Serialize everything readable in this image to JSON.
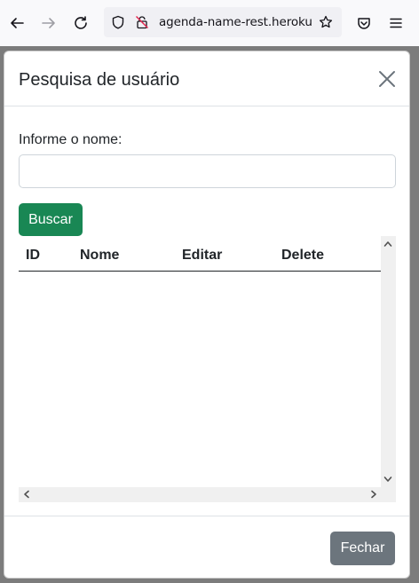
{
  "browser": {
    "url": "agenda-name-rest.herokuapp",
    "icons": [
      "back-arrow-icon",
      "forward-arrow-icon",
      "reload-icon",
      "shield-icon",
      "insecure-lock-icon",
      "star-icon",
      "pocket-icon",
      "hamburger-menu-icon"
    ]
  },
  "modal": {
    "title": "Pesquisa de usuário",
    "field_label": "Informe o nome:",
    "name_input": {
      "value": "",
      "placeholder": ""
    },
    "search_button": "Buscar",
    "table": {
      "headers": [
        "ID",
        "Nome",
        "Editar",
        "Delete"
      ],
      "rows": []
    },
    "footer_button": "Fechar"
  },
  "colors": {
    "search_button": "#198754",
    "footer_button": "#6c757d",
    "text": "#212529"
  }
}
